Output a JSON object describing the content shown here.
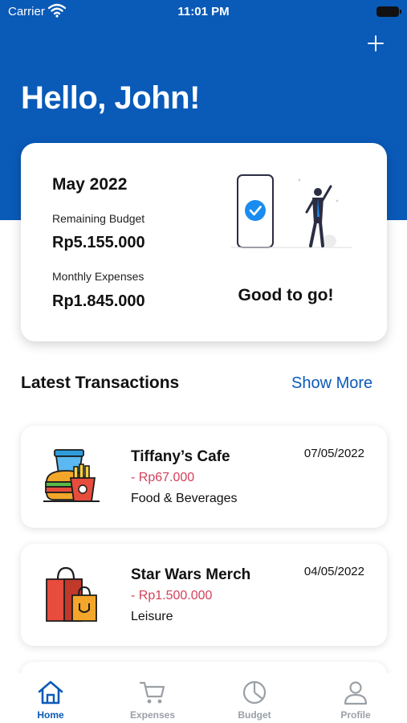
{
  "status_bar": {
    "carrier": "Carrier",
    "time": "11:01 PM"
  },
  "header": {
    "greeting": "Hello, John!",
    "add_icon": "plus-icon"
  },
  "summary": {
    "month": "May 2022",
    "remaining_label": "Remaining Budget",
    "remaining_value": "Rp5.155.000",
    "expenses_label": "Monthly Expenses",
    "expenses_value": "Rp1.845.000",
    "status_message": "Good to go!"
  },
  "transactions_section": {
    "title": "Latest Transactions",
    "show_more": "Show More"
  },
  "transactions": [
    {
      "name": "Tiffany’s Cafe",
      "amount": "- Rp67.000",
      "category": "Food & Beverages",
      "date": "07/05/2022",
      "icon": "food-icon"
    },
    {
      "name": "Star Wars Merch",
      "amount": "- Rp1.500.000",
      "category": "Leisure",
      "date": "04/05/2022",
      "icon": "shopping-bags-icon"
    }
  ],
  "tabs": [
    {
      "label": "Home",
      "icon": "home-icon",
      "active": true
    },
    {
      "label": "Expenses",
      "icon": "cart-icon",
      "active": false
    },
    {
      "label": "Budget",
      "icon": "pie-chart-icon",
      "active": false
    },
    {
      "label": "Profile",
      "icon": "user-icon",
      "active": false
    }
  ],
  "colors": {
    "primary": "#0a5ab8",
    "expense": "#d4405a",
    "inactive": "#9aa0a6"
  }
}
